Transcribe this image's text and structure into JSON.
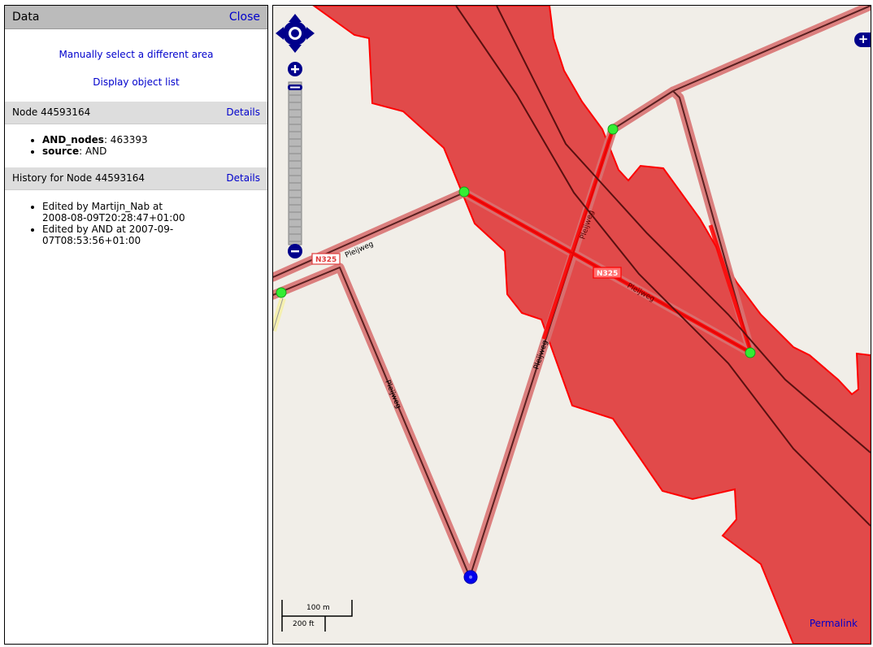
{
  "sidebar": {
    "title": "Data",
    "close_label": "Close",
    "manual_select_label": "Manually select a different area",
    "object_list_label": "Display object list",
    "node_section": {
      "title": "Node 44593164",
      "details_label": "Details",
      "tags": [
        {
          "key": "AND_nodes",
          "value": ": 463393"
        },
        {
          "key": "source",
          "value": ": AND"
        }
      ]
    },
    "history_section": {
      "title": "History for Node 44593164",
      "details_label": "Details",
      "entries": [
        {
          "line1": "Edited by Martijn_Nab at",
          "line2": "2008-08-09T20:28:47+01:00"
        },
        {
          "line1": "Edited by AND at 2007-09-07T08:53:56+01:00",
          "line2": ""
        }
      ]
    }
  },
  "map": {
    "road_labels": {
      "n325_a": "N325",
      "n325_b": "N325",
      "pleijweg_a": "Pleijweg",
      "pleijweg_b": "Pleijweg",
      "pleijweg_c": "Pleijweg",
      "pleijweg_d": "Pleijweg",
      "pleijweg_e": "Pleijweg"
    },
    "scale": {
      "metric": "100 m",
      "imperial": "200 ft"
    },
    "permalink_label": "Permalink",
    "layer_switcher_glyph": "+",
    "colors": {
      "area_fill": "#e03c3c",
      "area_stroke": "#ff0000",
      "background": "#f1eee8",
      "node_green": "#33ee33",
      "node_blue": "#0000ee",
      "road_fill": "#d97373",
      "road_line": "#5a2020"
    }
  }
}
